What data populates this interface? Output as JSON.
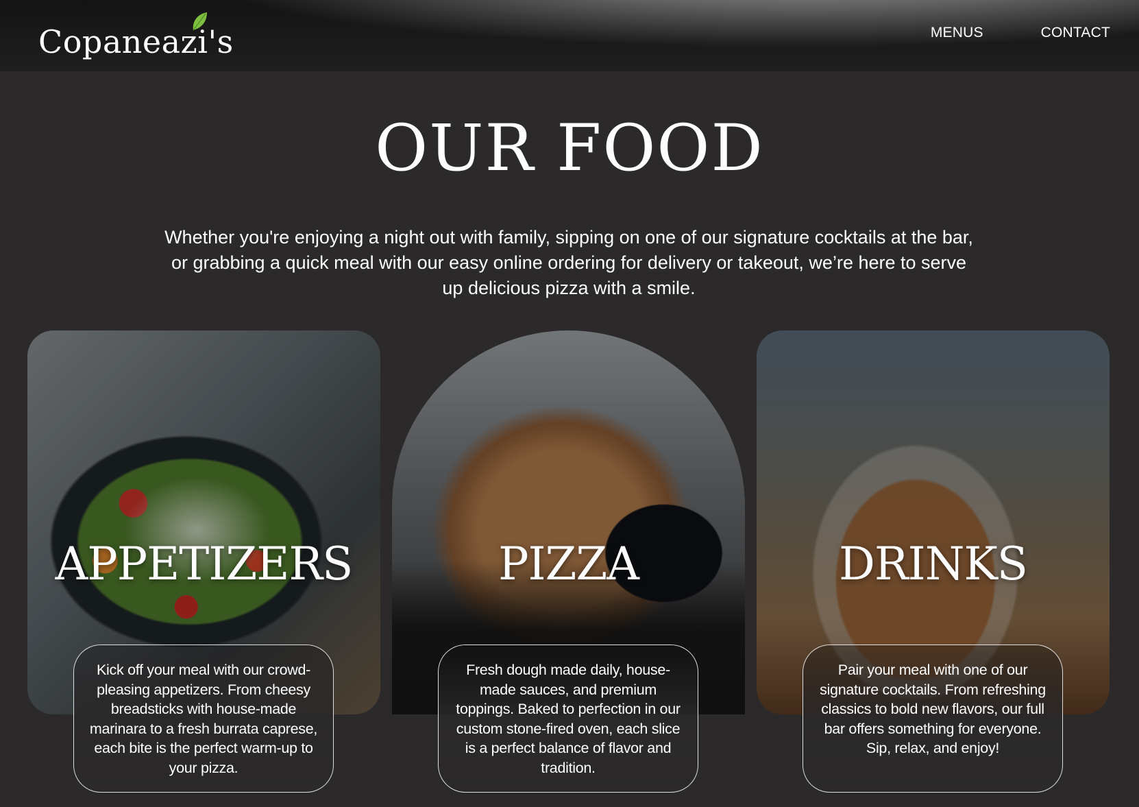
{
  "header": {
    "logo_text": "Copaneazi's",
    "nav": [
      {
        "label": "MENUS"
      },
      {
        "label": "CONTACT"
      }
    ]
  },
  "main": {
    "title": "OUR FOOD",
    "intro": "Whether you're enjoying a night out with family, sipping on one of our signature cocktails at the bar, or grabbing a quick meal with our easy online ordering for delivery or takeout, we’re here to serve up delicious pizza with a smile.",
    "cards": [
      {
        "heading": "APPETIZERS",
        "description": "Kick off your meal with our crowd-pleasing appetizers. From cheesy breadsticks with house-made marinara to a fresh burrata caprese, each bite is the perfect warm-up to your pizza."
      },
      {
        "heading": "PIZZA",
        "description": "Fresh dough made daily, house-made sauces, and premium toppings. Baked to perfection in our custom stone-fired oven, each slice is a perfect balance of flavor and tradition."
      },
      {
        "heading": "DRINKS",
        "description": "Pair your meal with one of our signature cocktails. From refreshing classics to bold new flavors, our full bar offers something for everyone. Sip, relax, and enjoy!"
      }
    ]
  },
  "colors": {
    "background": "#2b292a",
    "header": "#1a1a1a",
    "text": "#ffffff",
    "leaf": "#7fbf3f"
  }
}
